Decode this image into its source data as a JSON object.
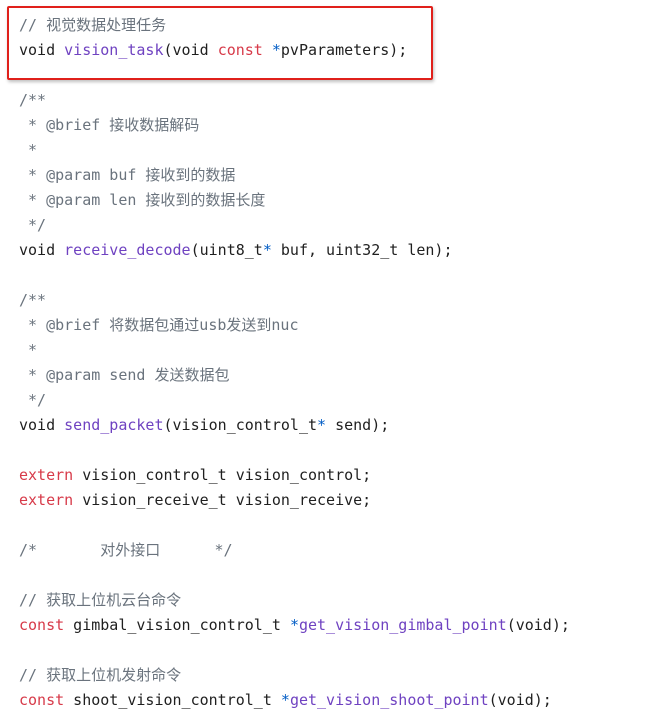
{
  "highlight_color": "#e0201b",
  "colors": {
    "comment": "#6a737d",
    "keyword": "#d73a49",
    "function": "#6f42c1",
    "operator": "#005cc5",
    "text": "#1f1f1f"
  },
  "lines": [
    [
      {
        "t": "// 视觉数据处理任务",
        "c": "cm"
      }
    ],
    [
      {
        "t": "void ",
        "c": "pl"
      },
      {
        "t": "vision_task",
        "c": "fn"
      },
      {
        "t": "(void ",
        "c": "pl"
      },
      {
        "t": "const",
        "c": "kw"
      },
      {
        "t": " ",
        "c": "pl"
      },
      {
        "t": "*",
        "c": "op"
      },
      {
        "t": "pvParameters);",
        "c": "pl"
      }
    ],
    [],
    [
      {
        "t": "/**",
        "c": "cm"
      }
    ],
    [
      {
        "t": " * @brief 接收数据解码",
        "c": "cm"
      }
    ],
    [
      {
        "t": " *",
        "c": "cm"
      }
    ],
    [
      {
        "t": " * @param buf 接收到的数据",
        "c": "cm"
      }
    ],
    [
      {
        "t": " * @param len 接收到的数据长度",
        "c": "cm"
      }
    ],
    [
      {
        "t": " */",
        "c": "cm"
      }
    ],
    [
      {
        "t": "void ",
        "c": "pl"
      },
      {
        "t": "receive_decode",
        "c": "fn"
      },
      {
        "t": "(uint8_t",
        "c": "pl"
      },
      {
        "t": "*",
        "c": "op"
      },
      {
        "t": " buf, uint32_t len);",
        "c": "pl"
      }
    ],
    [],
    [
      {
        "t": "/**",
        "c": "cm"
      }
    ],
    [
      {
        "t": " * @brief 将数据包通过usb发送到nuc",
        "c": "cm"
      }
    ],
    [
      {
        "t": " *",
        "c": "cm"
      }
    ],
    [
      {
        "t": " * @param send 发送数据包",
        "c": "cm"
      }
    ],
    [
      {
        "t": " */",
        "c": "cm"
      }
    ],
    [
      {
        "t": "void ",
        "c": "pl"
      },
      {
        "t": "send_packet",
        "c": "fn"
      },
      {
        "t": "(vision_control_t",
        "c": "pl"
      },
      {
        "t": "*",
        "c": "op"
      },
      {
        "t": " send);",
        "c": "pl"
      }
    ],
    [],
    [
      {
        "t": "extern",
        "c": "kw"
      },
      {
        "t": " vision_control_t vision_control;",
        "c": "pl"
      }
    ],
    [
      {
        "t": "extern",
        "c": "kw"
      },
      {
        "t": " vision_receive_t vision_receive;",
        "c": "pl"
      }
    ],
    [],
    [
      {
        "t": "/*       对外接口      */",
        "c": "cm"
      }
    ],
    [],
    [
      {
        "t": "// 获取上位机云台命令",
        "c": "cm"
      }
    ],
    [
      {
        "t": "const",
        "c": "kw"
      },
      {
        "t": " gimbal_vision_control_t ",
        "c": "pl"
      },
      {
        "t": "*",
        "c": "op"
      },
      {
        "t": "get_vision_gimbal_point",
        "c": "fn"
      },
      {
        "t": "(void);",
        "c": "pl"
      }
    ],
    [],
    [
      {
        "t": "// 获取上位机发射命令",
        "c": "cm"
      }
    ],
    [
      {
        "t": "const",
        "c": "kw"
      },
      {
        "t": " shoot_vision_control_t ",
        "c": "pl"
      },
      {
        "t": "*",
        "c": "op"
      },
      {
        "t": "get_vision_shoot_point",
        "c": "fn"
      },
      {
        "t": "(void);",
        "c": "pl"
      }
    ]
  ]
}
